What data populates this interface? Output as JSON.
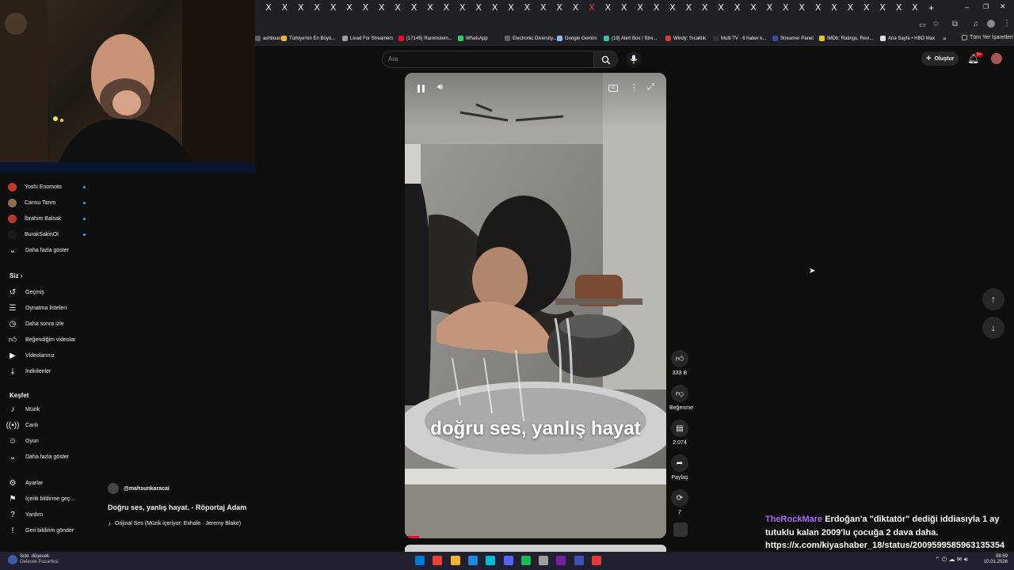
{
  "browser": {
    "tab_close_glyph": "X",
    "new_tab_glyph": "+",
    "bookmarks": [
      {
        "label": "ashboard",
        "color": "#5f6368"
      },
      {
        "label": "Türkiye'nin En Büyü...",
        "color": "#f2b233"
      },
      {
        "label": "Livad For Streamers",
        "color": "#9aa0a6"
      },
      {
        "label": "(17145) Rammstein...",
        "color": "#ff0033"
      },
      {
        "label": "WhatsApp",
        "color": "#25d366"
      },
      {
        "label": "Electronic Diversity...",
        "color": "#5f6368"
      },
      {
        "label": "Google Gemini",
        "color": "#8ab4f8"
      },
      {
        "label": "(19) Alert Box / Stre...",
        "color": "#31c3a2"
      },
      {
        "label": "Windy: Sıcaklık",
        "color": "#e53935"
      },
      {
        "label": "Multi TV - 6 haber k...",
        "color": "#333333"
      },
      {
        "label": "Streamer Panel",
        "color": "#3949ab"
      },
      {
        "label": "IMDb: Ratings, Revi...",
        "color": "#f5c518"
      },
      {
        "label": "Ana Sayfa • HBO Max",
        "color": "#e0e0e0"
      }
    ],
    "more_bookmarks": "»",
    "all_bookmarks": "Tüm Yer İşaretleri"
  },
  "header": {
    "search_placeholder": "Ara",
    "create_label": "Oluştur",
    "notification_badge": "9+"
  },
  "sidebar": {
    "subscriptions": [
      {
        "name": "Yoshi Enomoto",
        "color": "#c0392b"
      },
      {
        "name": "Cansu Tanm",
        "color": "#8e6e53"
      },
      {
        "name": "İbrahim Balsak",
        "color": "#b03a2e"
      },
      {
        "name": "BurakSakinOl",
        "color": "#1a1a1a"
      }
    ],
    "show_more": "Daha fazla göster",
    "you_heading": "Siz",
    "you_items": [
      "Geçmiş",
      "Oynatma listeleri",
      "Daha sonra izle",
      "Beğendiğim videolar",
      "Videolarınız",
      "İndirilenler"
    ],
    "explore_heading": "Keşfet",
    "explore_items": [
      "Müzik",
      "Canlı",
      "Oyun",
      "Daha fazla göster"
    ],
    "bottom_items": [
      "Ayarlar",
      "İçerik bildirme geç...",
      "Yardım",
      "Geri bildirim gönder"
    ]
  },
  "short": {
    "channel": "@mahsunkaracai",
    "title": "Doğru ses, yanlış hayat.  - Röportaj Adam",
    "sound": "Orijinal Ses (Müzik içeriyor: Exhale · Jeremy Blake)",
    "caption": "doğru ses, yanlış hayat",
    "likes": "333 B",
    "dislike_label": "Beğenme",
    "comments": "2.074",
    "share_label": "Paylaş",
    "remix_count": "7"
  },
  "chat": {
    "user": "TheRockMare",
    "user_color": "#b36bff",
    "message": "Erdoğan'a \"diktatör\" dediği iddiasıyla 1 ay tutuklu kalan 2009'lu çocuğa 2 dava daha. https://x.com/kiyashaber_18/status/2009599585963135354"
  },
  "taskbar": {
    "weather_temp": "Sckl. düşecek",
    "weather_sub": "Gelecek Pazartesi",
    "time": "08:59",
    "date": "10.01.2026"
  }
}
